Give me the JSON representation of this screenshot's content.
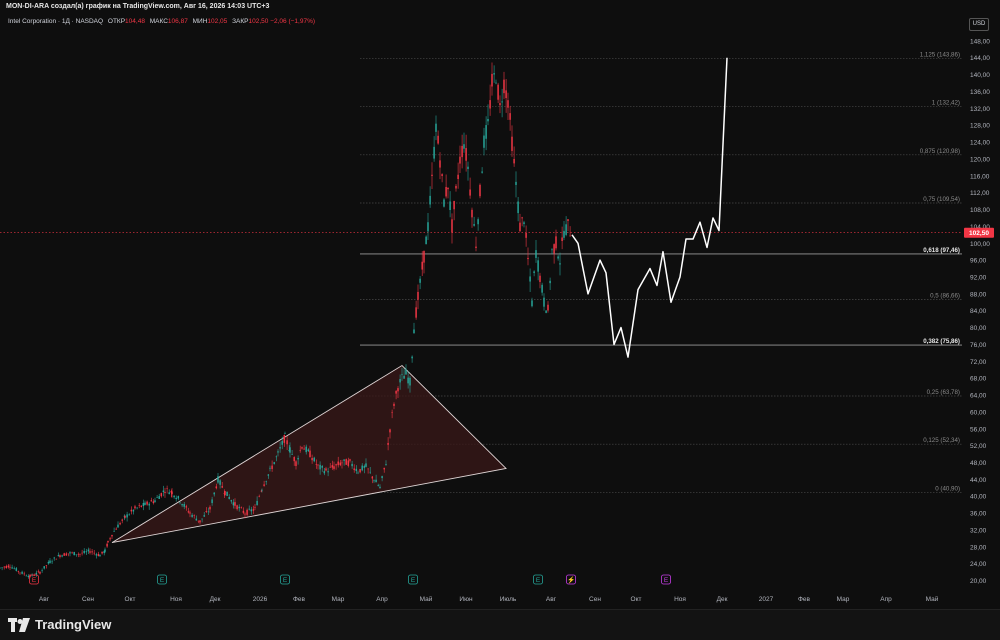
{
  "header": {
    "text": "MON-DI-ARA создал(а) график на TradingView.com, Авг 16, 2026 14:03 UTC+3"
  },
  "legend": {
    "symbol": "Intel Corporation · 1Д · NASDAQ",
    "open_label": "ОТКР",
    "open": "104,48",
    "high_label": "МАКС",
    "high": "106,87",
    "low_label": "МИН",
    "low": "102,05",
    "close_label": "ЗАКР",
    "close": "102,50",
    "change": "−2,06 (−1,97%)"
  },
  "currency": "USD",
  "brand": {
    "name": "TradingView",
    "icon": "tradingview-logo-icon"
  },
  "colors": {
    "up": "#26a69a",
    "down": "#f23645",
    "price_tag": "#f23645",
    "triangle_fill": "#3a1818"
  },
  "chart_data": {
    "type": "candlestick",
    "ylim": [
      18,
      152
    ],
    "y_ticks": [
      "20,00",
      "24,00",
      "28,00",
      "32,00",
      "36,00",
      "40,00",
      "44,00",
      "48,00",
      "52,00",
      "56,00",
      "60,00",
      "64,00",
      "68,00",
      "72,00",
      "76,00",
      "80,00",
      "84,00",
      "88,00",
      "92,00",
      "96,00",
      "100,00",
      "104,00",
      "108,00",
      "112,00",
      "116,00",
      "120,00",
      "124,00",
      "128,00",
      "132,00",
      "136,00",
      "140,00",
      "144,00",
      "148,00"
    ],
    "x_ticks": [
      "Авг",
      "Сен",
      "Окт",
      "Ноя",
      "Дек",
      "2026",
      "Фев",
      "Мар",
      "Апр",
      "Май",
      "Июн",
      "Июль",
      "Авг",
      "Сен",
      "Окт",
      "Ноя",
      "Дек",
      "2027",
      "Фев",
      "Мар",
      "Апр",
      "Май"
    ],
    "last_price": "102,50",
    "fib_levels": [
      {
        "label": "1,125 (143,86)",
        "value": 143.86,
        "bold": false
      },
      {
        "label": "1 (132,42)",
        "value": 132.42,
        "bold": false
      },
      {
        "label": "0,875 (120,98)",
        "value": 120.98,
        "bold": false
      },
      {
        "label": "0,75 (109,54)",
        "value": 109.54,
        "bold": false
      },
      {
        "label": "0,618 (97,46)",
        "value": 97.46,
        "bold": true
      },
      {
        "label": "0,5 (86,66)",
        "value": 86.66,
        "bold": false
      },
      {
        "label": "0,382 (75,86)",
        "value": 75.86,
        "bold": true
      },
      {
        "label": "0,25 (63,78)",
        "value": 63.78,
        "bold": false
      },
      {
        "label": "0,125 (52,34)",
        "value": 52.34,
        "bold": false
      },
      {
        "label": "0 (40,90)",
        "value": 40.9,
        "bold": false
      }
    ],
    "price_path": [
      [
        0,
        23
      ],
      [
        10,
        23.5
      ],
      [
        20,
        22
      ],
      [
        30,
        21
      ],
      [
        40,
        22
      ],
      [
        50,
        24.5
      ],
      [
        60,
        26
      ],
      [
        70,
        26.5
      ],
      [
        80,
        26.3
      ],
      [
        90,
        27
      ],
      [
        100,
        26
      ],
      [
        105,
        27
      ],
      [
        108,
        29
      ],
      [
        112,
        31
      ],
      [
        118,
        33
      ],
      [
        125,
        35
      ],
      [
        135,
        37
      ],
      [
        145,
        38
      ],
      [
        155,
        39
      ],
      [
        165,
        41.5
      ],
      [
        172,
        41
      ],
      [
        180,
        39
      ],
      [
        190,
        36
      ],
      [
        200,
        34
      ],
      [
        210,
        37
      ],
      [
        218,
        44
      ],
      [
        225,
        41
      ],
      [
        235,
        38
      ],
      [
        245,
        36
      ],
      [
        255,
        37
      ],
      [
        262,
        42
      ],
      [
        270,
        46
      ],
      [
        278,
        50
      ],
      [
        285,
        54
      ],
      [
        290,
        51
      ],
      [
        296,
        48
      ],
      [
        302,
        52
      ],
      [
        310,
        50
      ],
      [
        318,
        47
      ],
      [
        326,
        46
      ],
      [
        334,
        47
      ],
      [
        342,
        48
      ],
      [
        350,
        48
      ],
      [
        358,
        46
      ],
      [
        366,
        47
      ],
      [
        374,
        44
      ],
      [
        380,
        42
      ],
      [
        386,
        48
      ],
      [
        390,
        56
      ],
      [
        394,
        62
      ],
      [
        398,
        66
      ],
      [
        402,
        68
      ],
      [
        406,
        69
      ],
      [
        410,
        67
      ],
      [
        414,
        80
      ],
      [
        418,
        87
      ],
      [
        424,
        97
      ],
      [
        428,
        104
      ],
      [
        432,
        115
      ],
      [
        436,
        128
      ],
      [
        440,
        120
      ],
      [
        444,
        110
      ],
      [
        448,
        114
      ],
      [
        452,
        104
      ],
      [
        456,
        112
      ],
      [
        460,
        120
      ],
      [
        464,
        124
      ],
      [
        468,
        118
      ],
      [
        472,
        108
      ],
      [
        476,
        100
      ],
      [
        480,
        112
      ],
      [
        484,
        124
      ],
      [
        488,
        128
      ],
      [
        492,
        138
      ],
      [
        496,
        140
      ],
      [
        500,
        132
      ],
      [
        504,
        138
      ],
      [
        508,
        134
      ],
      [
        512,
        124
      ],
      [
        516,
        114
      ],
      [
        520,
        104
      ],
      [
        524,
        106
      ],
      [
        528,
        96
      ],
      [
        532,
        86
      ],
      [
        536,
        98
      ],
      [
        540,
        92
      ],
      [
        544,
        86
      ],
      [
        548,
        84
      ],
      [
        552,
        98
      ],
      [
        556,
        100
      ],
      [
        560,
        96
      ],
      [
        564,
        103
      ],
      [
        568,
        104
      ],
      [
        572,
        102
      ]
    ],
    "projection": [
      [
        572,
        102
      ],
      [
        578,
        100
      ],
      [
        588,
        88
      ],
      [
        600,
        96
      ],
      [
        606,
        93
      ],
      [
        614,
        76
      ],
      [
        621,
        80
      ],
      [
        628,
        73
      ],
      [
        638,
        89
      ],
      [
        650,
        94
      ],
      [
        657,
        90
      ],
      [
        663,
        98
      ],
      [
        671,
        86
      ],
      [
        680,
        92
      ],
      [
        686,
        101
      ],
      [
        693,
        101
      ],
      [
        700,
        105
      ],
      [
        707,
        99
      ],
      [
        713,
        106
      ],
      [
        719,
        103
      ],
      [
        727,
        144
      ]
    ],
    "triangle": {
      "points": [
        [
          112,
          29
        ],
        [
          402,
          71
        ],
        [
          506,
          46.6
        ]
      ]
    }
  }
}
